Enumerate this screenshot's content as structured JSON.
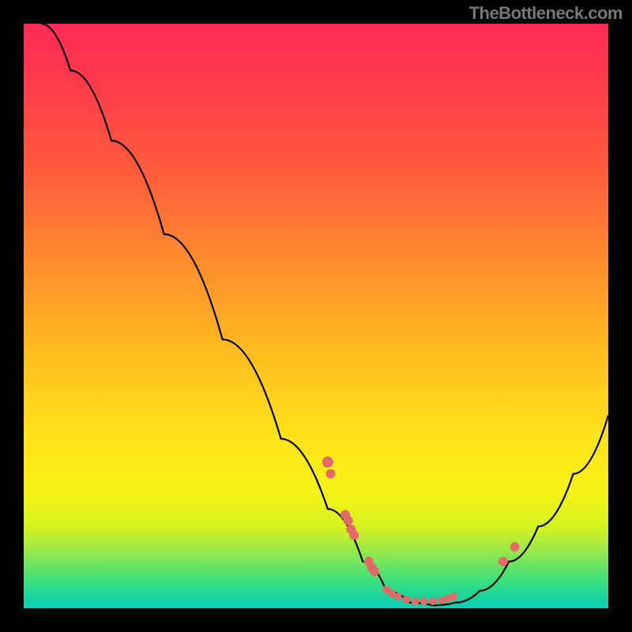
{
  "watermark": "TheBottleneck.com",
  "chart_data": {
    "type": "line",
    "title": "",
    "xlabel": "",
    "ylabel": "",
    "xlim": [
      0,
      100
    ],
    "ylim": [
      0,
      100
    ],
    "curve": {
      "name": "bottleneck-curve",
      "points": [
        {
          "x": 3,
          "y": 100
        },
        {
          "x": 8,
          "y": 92
        },
        {
          "x": 15,
          "y": 80
        },
        {
          "x": 24,
          "y": 64
        },
        {
          "x": 34,
          "y": 46
        },
        {
          "x": 44,
          "y": 29
        },
        {
          "x": 52,
          "y": 17
        },
        {
          "x": 58,
          "y": 8
        },
        {
          "x": 62,
          "y": 3
        },
        {
          "x": 66,
          "y": 1
        },
        {
          "x": 70,
          "y": 0.5
        },
        {
          "x": 74,
          "y": 1
        },
        {
          "x": 78,
          "y": 3
        },
        {
          "x": 83,
          "y": 8
        },
        {
          "x": 88,
          "y": 14
        },
        {
          "x": 94,
          "y": 23
        },
        {
          "x": 100,
          "y": 33
        }
      ]
    },
    "markers": [
      {
        "x": 52,
        "y": 25,
        "r": 7
      },
      {
        "x": 52.5,
        "y": 23,
        "r": 6
      },
      {
        "x": 55,
        "y": 16,
        "r": 6
      },
      {
        "x": 55.5,
        "y": 15,
        "r": 6
      },
      {
        "x": 56,
        "y": 13.5,
        "r": 6
      },
      {
        "x": 56.5,
        "y": 12.5,
        "r": 6
      },
      {
        "x": 59,
        "y": 8,
        "r": 6
      },
      {
        "x": 59.5,
        "y": 7,
        "r": 6
      },
      {
        "x": 60,
        "y": 6.3,
        "r": 6
      },
      {
        "x": 62,
        "y": 3.2,
        "r": 5
      },
      {
        "x": 63,
        "y": 2.5,
        "r": 5
      },
      {
        "x": 64,
        "y": 2,
        "r": 5
      },
      {
        "x": 65.5,
        "y": 1.5,
        "r": 5
      },
      {
        "x": 67,
        "y": 1.2,
        "r": 5
      },
      {
        "x": 68.5,
        "y": 1.2,
        "r": 5
      },
      {
        "x": 70,
        "y": 1.2,
        "r": 5
      },
      {
        "x": 71.5,
        "y": 1.4,
        "r": 5
      },
      {
        "x": 72.5,
        "y": 1.7,
        "r": 5
      },
      {
        "x": 73.5,
        "y": 2,
        "r": 5
      },
      {
        "x": 82,
        "y": 8,
        "r": 6
      },
      {
        "x": 84,
        "y": 10.5,
        "r": 6
      }
    ],
    "gradient_stops": [
      {
        "pos": 0,
        "color": "#ff2a55"
      },
      {
        "pos": 40,
        "color": "#ff8a2e"
      },
      {
        "pos": 70,
        "color": "#ffe21a"
      },
      {
        "pos": 95,
        "color": "#3fe07a"
      },
      {
        "pos": 100,
        "color": "#0fcfba"
      }
    ]
  }
}
